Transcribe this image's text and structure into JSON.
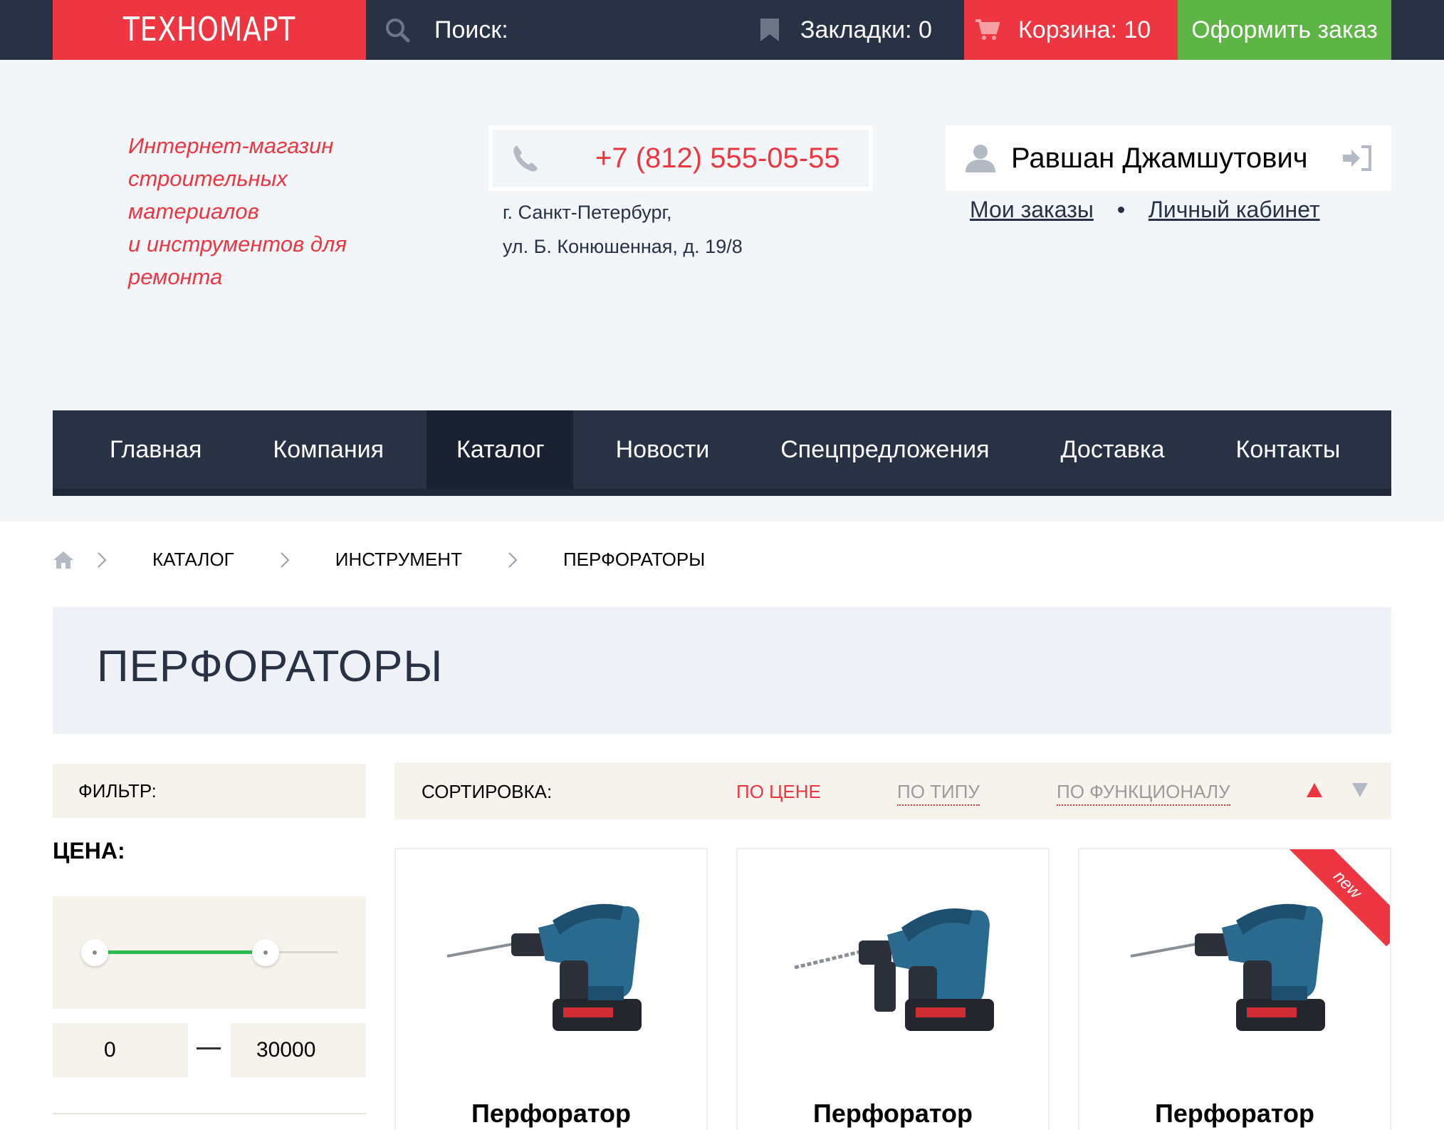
{
  "topbar": {
    "logo": "ТЕХНОМАРТ",
    "search_label": "Поиск:",
    "bookmarks": "Закладки: 0",
    "cart": "Корзина: 10",
    "checkout": "Оформить заказ"
  },
  "header": {
    "tagline": [
      "Интернет-магазин",
      "строительных",
      "материалов",
      "и инструментов для",
      "ремонта"
    ],
    "phone": "+7 (812) 555-05-55",
    "address_line1": "г. Санкт-Петербург,",
    "address_line2": "ул. Б. Конюшенная, д. 19/8",
    "user_name": "Равшан Джамшутович",
    "my_orders": "Мои заказы",
    "account": "Личный кабинет"
  },
  "nav": {
    "items": [
      {
        "label": "Главная",
        "active": false
      },
      {
        "label": "Компания",
        "active": false
      },
      {
        "label": "Каталог",
        "active": true
      },
      {
        "label": "Новости",
        "active": false
      },
      {
        "label": "Спецпредложения",
        "active": false
      },
      {
        "label": "Доставка",
        "active": false
      },
      {
        "label": "Контакты",
        "active": false
      }
    ]
  },
  "breadcrumbs": [
    "КАТАЛОГ",
    "ИНСТРУМЕНТ",
    "ПЕРФОРАТОРЫ"
  ],
  "page_title": "ПЕРФОРАТОРЫ",
  "filter": {
    "label": "ФИЛЬТР:",
    "price_label": "ЦЕНА:",
    "price_min": "0",
    "price_max": "30000"
  },
  "sort": {
    "label": "СОРТИРОВКА:",
    "options": [
      {
        "label": "ПО ЦЕНЕ",
        "active": true
      },
      {
        "label": "ПО ТИПУ",
        "active": false
      },
      {
        "label": "ПО ФУНКЦИОНАЛУ",
        "active": false
      }
    ]
  },
  "products": [
    {
      "name": "Перфоратор",
      "badge": ""
    },
    {
      "name": "Перфоратор",
      "badge": ""
    },
    {
      "name": "Перфоратор",
      "badge": "new"
    }
  ],
  "colors": {
    "brand_red": "#ee3643",
    "dark": "#283244",
    "green": "#5cb545"
  }
}
